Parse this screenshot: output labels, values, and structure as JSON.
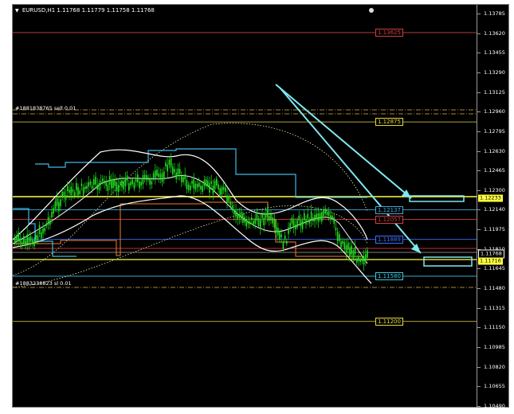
{
  "window": {
    "symbol_header": "EURUSD,H1  1.11768 1.11779 1.11758 1.11768",
    "triangle_icon": "triangle-down-icon"
  },
  "price_axis": {
    "ticks": [
      "1.13785",
      "1.13620",
      "1.13455",
      "1.13290",
      "1.13125",
      "1.12960",
      "1.12795",
      "1.12630",
      "1.12465",
      "1.12300",
      "1.12140",
      "1.11975",
      "1.11810",
      "1.11645",
      "1.11480",
      "1.11315",
      "1.11150",
      "1.10985",
      "1.10820",
      "1.10655",
      "1.10490"
    ],
    "current_price": "1.11768",
    "tag_price": "1.11716",
    "yellow_tag": "1.12233"
  },
  "levels": [
    {
      "price": "1.13625",
      "color": "#d04040"
    },
    {
      "price": "1.12875",
      "color": "#e8d840"
    },
    {
      "price": "1.12137",
      "color": "#40a8d0"
    },
    {
      "price": "1.12057",
      "color": "#d04040"
    },
    {
      "price": "1.11889",
      "color": "#4070ff"
    },
    {
      "price": "1.11580",
      "color": "#40c8e0"
    },
    {
      "price": "1.11200",
      "color": "#e8d840"
    }
  ],
  "orders": [
    {
      "text": "#1881838765 sell 0.01"
    },
    {
      "text": "#1883238823 sl   0.01"
    }
  ],
  "colors": {
    "background": "#000000",
    "candles": "#20e020",
    "yellow_line": "#ffff40",
    "cyan_line": "#40b8e8",
    "orange_line": "#f08030",
    "arrow": "#80e8f0"
  }
}
